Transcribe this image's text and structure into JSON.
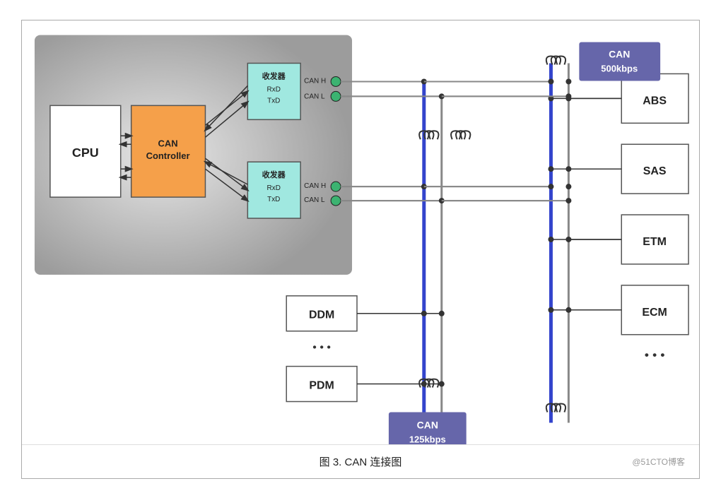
{
  "diagram": {
    "title": "图 3.   CAN 连接图",
    "watermark": "@51CTO博客",
    "cpu_label": "CPU",
    "can_controller_label": "CAN\nController",
    "transceiver1_label": "收发器",
    "transceiver1_rx": "RxD",
    "transceiver1_tx": "TxD",
    "transceiver1_canh": "CAN H",
    "transceiver1_canl": "CAN L",
    "transceiver2_label": "收发器",
    "transceiver2_rx": "RxD",
    "transceiver2_tx": "TxD",
    "transceiver2_canh": "CAN H",
    "transceiver2_canl": "CAN L",
    "can_500_label": "CAN\n500kbps",
    "can_125_label": "CAN\n125kbps",
    "nodes_left": [
      "DDM",
      "PDM"
    ],
    "nodes_right": [
      "ABS",
      "SAS",
      "ETM",
      "ECM"
    ],
    "dots_label": "..."
  }
}
